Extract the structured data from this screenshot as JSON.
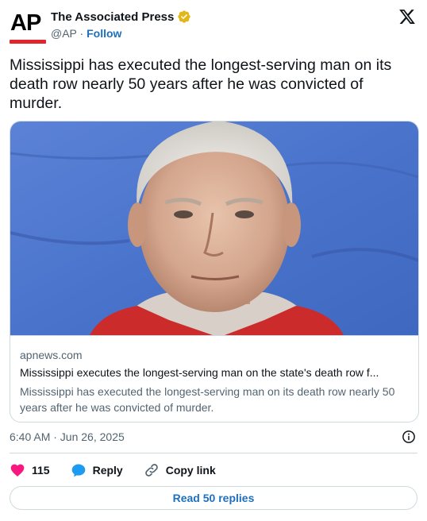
{
  "account": {
    "logo_text": "AP",
    "name": "The Associated Press",
    "handle": "@AP",
    "separator": "·",
    "follow_label": "Follow"
  },
  "tweet": {
    "text": "Mississippi has executed the longest-serving man on its death row nearly 50 years after he was convicted of murder."
  },
  "card": {
    "domain": "apnews.com",
    "title": "Mississippi executes the longest-serving man on the state's death row f...",
    "description": "Mississippi has executed the longest-serving man on its death row nearly 50 years after he was convicted of murder."
  },
  "meta": {
    "timestamp": "6:40 AM · Jun 26, 2025"
  },
  "actions": {
    "like_count": "115",
    "reply_label": "Reply",
    "copy_link_label": "Copy link"
  },
  "replies_button": "Read 50 replies",
  "colors": {
    "brand_red": "#e0252b",
    "link_blue": "#1d6fbf",
    "heart": "#f91880",
    "reply_icon": "#1d9bf0",
    "verified_gold": "#e2b719"
  },
  "icons": [
    "verified-badge-icon",
    "x-logo-icon",
    "info-icon",
    "heart-icon",
    "reply-bubble-icon",
    "link-icon"
  ]
}
